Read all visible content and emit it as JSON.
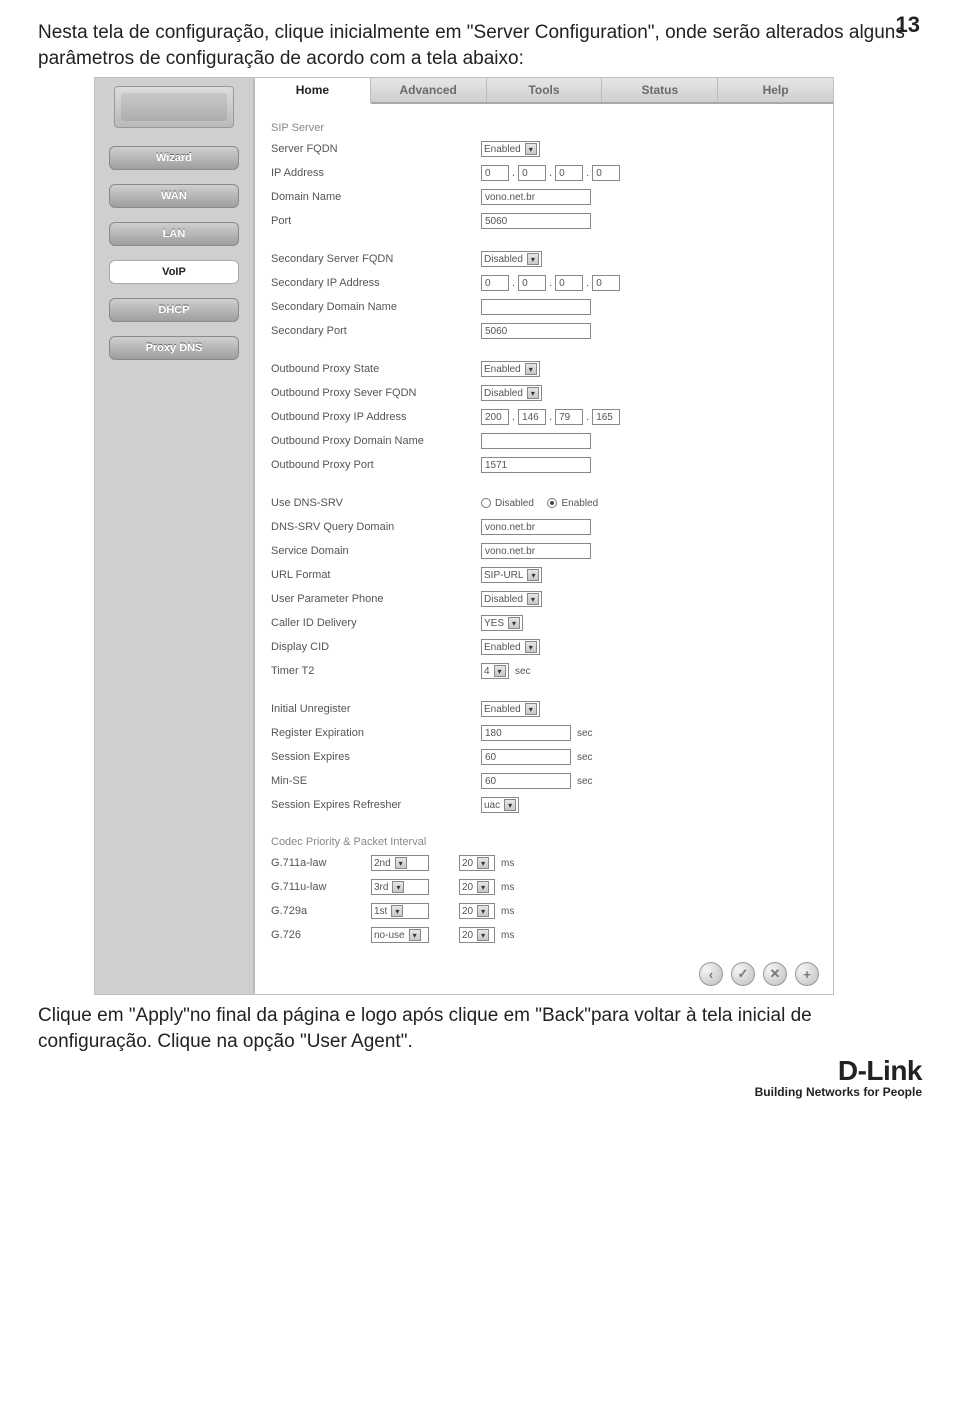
{
  "page_number": "13",
  "intro_text": "Nesta tela de configuração, clique inicialmente em \"Server Configuration\", onde serão alterados alguns parâmetros de configuração de acordo com a tela abaixo:",
  "outro_text": "Clique em \"Apply\"no final da página e logo após clique em \"Back\"para voltar à tela inicial de configuração. Clique na opção \"User Agent\".",
  "brand": {
    "name": "D-Link",
    "tagline": "Building Networks for People"
  },
  "sidebar": {
    "items": [
      "Wizard",
      "WAN",
      "LAN",
      "VoIP",
      "DHCP",
      "Proxy DNS"
    ],
    "active": "VoIP"
  },
  "tabs": {
    "items": [
      "Home",
      "Advanced",
      "Tools",
      "Status",
      "Help"
    ],
    "active": "Home"
  },
  "sip_server": {
    "title": "SIP Server",
    "server_fqdn_label": "Server FQDN",
    "server_fqdn_value": "Enabled",
    "ip_label": "IP Address",
    "ip_value": [
      "0",
      "0",
      "0",
      "0"
    ],
    "domain_label": "Domain Name",
    "domain_value": "vono.net.br",
    "port_label": "Port",
    "port_value": "5060"
  },
  "secondary": {
    "fqdn_label": "Secondary Server FQDN",
    "fqdn_value": "Disabled",
    "ip_label": "Secondary IP Address",
    "ip_value": [
      "0",
      "0",
      "0",
      "0"
    ],
    "domain_label": "Secondary Domain Name",
    "domain_value": "",
    "port_label": "Secondary Port",
    "port_value": "5060"
  },
  "outbound": {
    "state_label": "Outbound Proxy State",
    "state_value": "Enabled",
    "fqdn_label": "Outbound Proxy Sever FQDN",
    "fqdn_value": "Disabled",
    "ip_label": "Outbound Proxy IP Address",
    "ip_value": [
      "200",
      "146",
      "79",
      "165"
    ],
    "domain_label": "Outbound Proxy Domain Name",
    "domain_value": "",
    "port_label": "Outbound Proxy Port",
    "port_value": "1571"
  },
  "dns_block": {
    "use_dns_srv_label": "Use DNS-SRV",
    "use_dns_srv_disabled": "Disabled",
    "use_dns_srv_enabled": "Enabled",
    "query_domain_label": "DNS-SRV Query Domain",
    "query_domain_value": "vono.net.br",
    "service_domain_label": "Service Domain",
    "service_domain_value": "vono.net.br",
    "url_format_label": "URL Format",
    "url_format_value": "SIP-URL",
    "user_param_label": "User Parameter Phone",
    "user_param_value": "Disabled",
    "caller_id_label": "Caller ID Delivery",
    "caller_id_value": "YES",
    "display_cid_label": "Display CID",
    "display_cid_value": "Enabled",
    "timer_t2_label": "Timer T2",
    "timer_t2_value": "4",
    "sec_unit": "sec"
  },
  "reg_block": {
    "initial_unreg_label": "Initial Unregister",
    "initial_unreg_value": "Enabled",
    "reg_exp_label": "Register Expiration",
    "reg_exp_value": "180",
    "session_exp_label": "Session Expires",
    "session_exp_value": "60",
    "min_se_label": "Min-SE",
    "min_se_value": "60",
    "refresher_label": "Session Expires Refresher",
    "refresher_value": "uac",
    "sec_unit": "sec"
  },
  "codec": {
    "title": "Codec Priority & Packet Interval",
    "ms_unit": "ms",
    "rows": [
      {
        "name": "G.711a-law",
        "prio": "2nd",
        "ms": "20"
      },
      {
        "name": "G.711u-law",
        "prio": "3rd",
        "ms": "20"
      },
      {
        "name": "G.729a",
        "prio": "1st",
        "ms": "20"
      },
      {
        "name": "G.726",
        "prio": "no-use",
        "ms": "20"
      }
    ]
  },
  "action_icons": {
    "back": "‹",
    "apply": "✓",
    "cancel": "✕",
    "add": "+"
  }
}
